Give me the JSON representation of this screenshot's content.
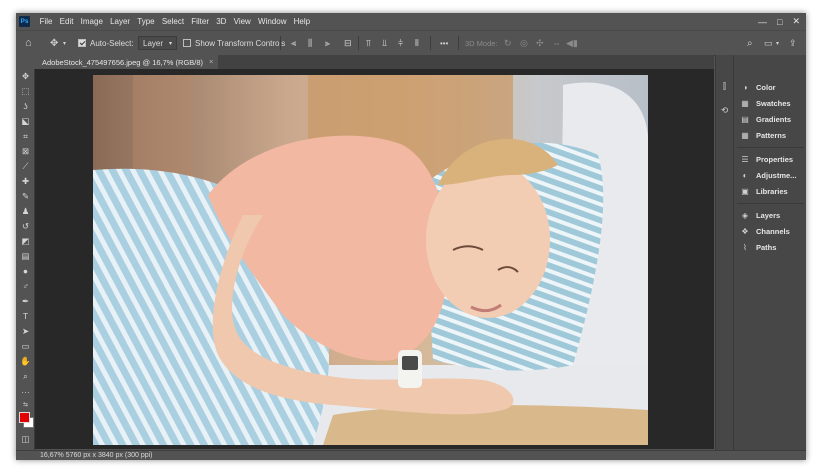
{
  "app": {
    "logo_text": "Ps"
  },
  "menu": [
    "File",
    "Edit",
    "Image",
    "Layer",
    "Type",
    "Select",
    "Filter",
    "3D",
    "View",
    "Window",
    "Help"
  ],
  "window_controls": {
    "minimize": "—",
    "maximize": "□",
    "close": "✕"
  },
  "options_bar": {
    "home_icon": "⌂",
    "move_icon": "✥",
    "auto_select_label": "Auto-Select:",
    "auto_select_checked": true,
    "layer_select_value": "Layer",
    "show_transform_label": "Show Transform Controls",
    "show_transform_checked": false,
    "more_label": "•••",
    "mode_3d_label": "3D Mode:"
  },
  "document_tab": {
    "title": "AdobeStock_475497656.jpeg @ 16,7% (RGB/8)",
    "close": "×"
  },
  "right_panel": {
    "group1": [
      "Color",
      "Swatches",
      "Gradients",
      "Patterns"
    ],
    "group2": [
      "Properties",
      "Adjustme...",
      "Libraries"
    ],
    "group3": [
      "Layers",
      "Channels",
      "Paths"
    ]
  },
  "status_bar": {
    "zoom": "16,67%",
    "doc_info": "5760 px x 3840 px (300 ppi)"
  },
  "colors": {
    "foreground": "#e30000",
    "background": "#ffffff",
    "ui_bg": "#535353",
    "panel_bg": "#474747",
    "canvas_bg": "#282828"
  }
}
